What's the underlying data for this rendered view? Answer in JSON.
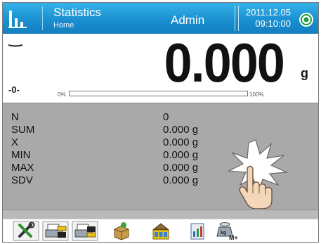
{
  "header": {
    "title": "Statistics",
    "subtitle": "Home",
    "user": "Admin",
    "date": "2011.12.05",
    "time": "09:10:00",
    "icons": {
      "logo": "statistics-chart-icon",
      "status": "level-target-icon"
    }
  },
  "weighing": {
    "value": "0.000",
    "unit": "g",
    "zero_indicator": "-0-",
    "stability_icon": "stability-marker-icon",
    "bargraph": {
      "min_label": "0%",
      "max_label": "100%",
      "fill": 0
    }
  },
  "statistics": {
    "rows": [
      {
        "label": "N",
        "value": "0"
      },
      {
        "label": "SUM",
        "value": "0.000 g"
      },
      {
        "label": "X",
        "value": "0.000 g"
      },
      {
        "label": "MIN",
        "value": "0.000 g"
      },
      {
        "label": "MAX",
        "value": "0.000 g"
      },
      {
        "label": "SDV",
        "value": "0.000 g"
      }
    ],
    "gesture_icon": "tap-hand-icon"
  },
  "toolbar": {
    "buttons": [
      {
        "icon": "tools-settings-icon"
      },
      {
        "icon": "print-header-icon"
      },
      {
        "icon": "print-footer-icon"
      },
      {
        "icon": "product-box-icon"
      },
      {
        "icon": "number-stack-icon"
      },
      {
        "icon": "report-book-icon"
      },
      {
        "icon": "weight-memory-add-icon"
      }
    ]
  },
  "colors": {
    "header_top": "#35b3ea",
    "header_bottom": "#127fc0",
    "stats_background": "#a9a9a9",
    "text": "#111111"
  }
}
